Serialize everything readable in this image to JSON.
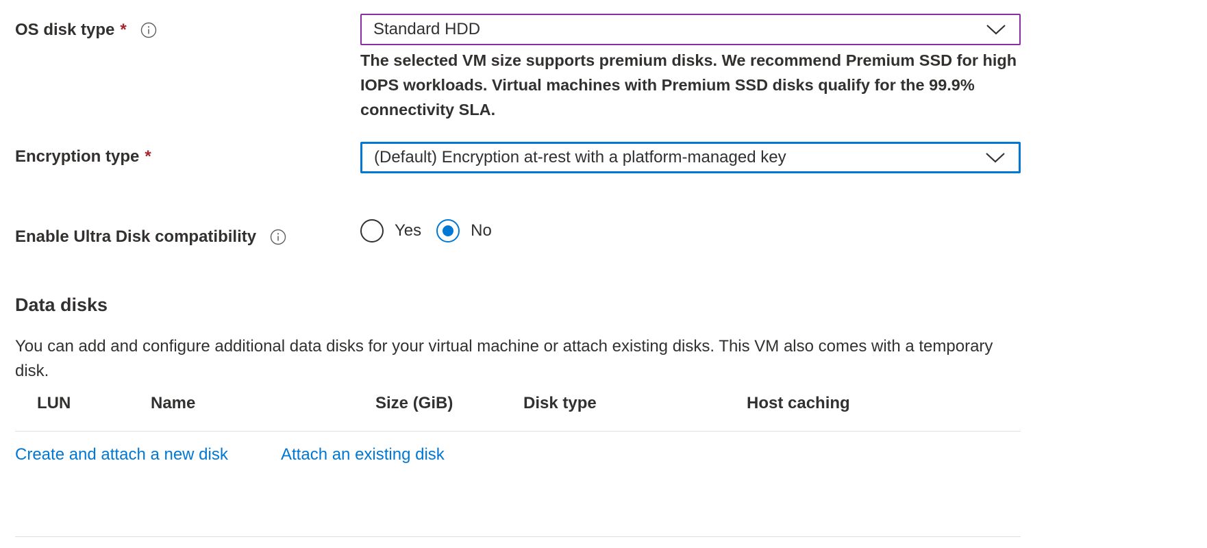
{
  "os_disk": {
    "label": "OS disk type",
    "required_mark": "*",
    "info_icon": "info-icon",
    "value": "Standard HDD",
    "note": "The selected VM size supports premium disks. We recommend Premium SSD for high IOPS workloads. Virtual machines with Premium SSD disks qualify for the 99.9% connectivity SLA."
  },
  "encryption": {
    "label": "Encryption type",
    "required_mark": "*",
    "value": "(Default) Encryption at-rest with a platform-managed key"
  },
  "ultra_disk": {
    "label": "Enable Ultra Disk compatibility",
    "info_icon": "info-icon",
    "options": [
      {
        "label": "Yes",
        "selected": false
      },
      {
        "label": "No",
        "selected": true
      }
    ]
  },
  "data_disks": {
    "title": "Data disks",
    "description": "You can add and configure additional data disks for your virtual machine or attach existing disks. This VM also comes with a temporary disk.",
    "columns": [
      "LUN",
      "Name",
      "Size (GiB)",
      "Disk type",
      "Host caching"
    ],
    "create_link": "Create and attach a new disk",
    "attach_link": "Attach an existing disk"
  },
  "colors": {
    "accent": "#0078d4",
    "required": "#a4262c",
    "focus_purple": "#8a2da5",
    "text": "#323130"
  }
}
